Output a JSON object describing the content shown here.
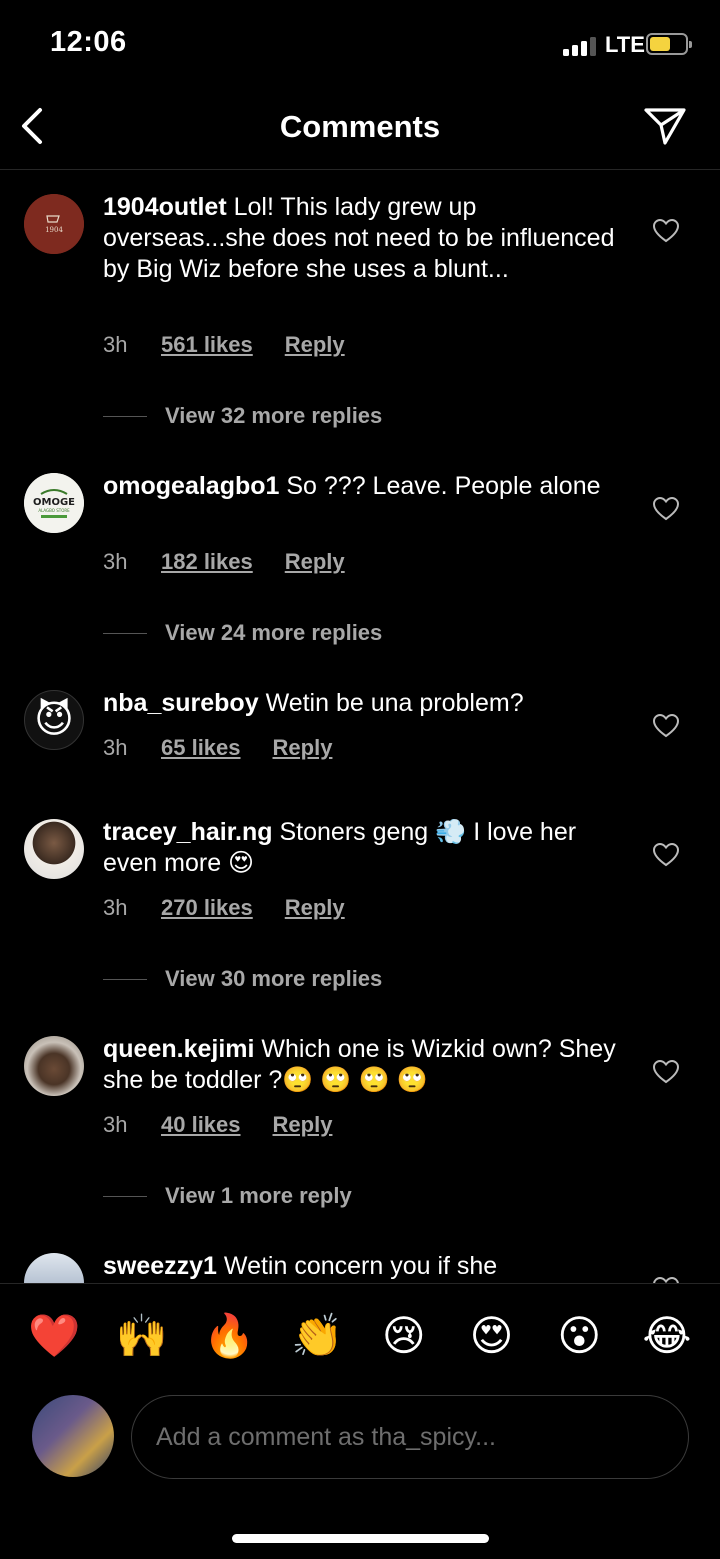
{
  "status": {
    "time": "12:06",
    "network": "LTE"
  },
  "header": {
    "title": "Comments"
  },
  "comments": [
    {
      "user": "1904outlet",
      "text": "Lol! This lady grew up overseas...she does not need to be influenced by Big Wiz before she uses a blunt...",
      "time": "3h",
      "likes": "561 likes",
      "reply": "Reply",
      "view_replies": "View 32 more replies"
    },
    {
      "user": "omogealagbo1",
      "text": "So ??? Leave. People alone",
      "time": "3h",
      "likes": "182 likes",
      "reply": "Reply",
      "view_replies": "View 24 more replies"
    },
    {
      "user": "nba_sureboy",
      "text": "Wetin be una problem?",
      "time": "3h",
      "likes": "65 likes",
      "reply": "Reply"
    },
    {
      "user": "tracey_hair.ng",
      "text": "Stoners geng 💨 I love her even more 😍",
      "time": "3h",
      "likes": "270 likes",
      "reply": "Reply",
      "view_replies": "View 30 more replies"
    },
    {
      "user": "queen.kejimi",
      "text": "Which one is Wizkid own? Shey she be toddler ?🙄 🙄 🙄 🙄",
      "time": "3h",
      "likes": "40 likes",
      "reply": "Reply",
      "view_replies": "View 1 more reply"
    },
    {
      "user": "sweezzy1",
      "text": "Wetin concern you if she"
    }
  ],
  "avatars": {
    "c1_label": "1904",
    "c2_label": "OMOGE",
    "c2_sub": "ALAGBO STORE"
  },
  "emoji_bar": [
    "❤️",
    "🙌",
    "🔥",
    "👏",
    "😢",
    "😍",
    "😮",
    "😂"
  ],
  "input": {
    "placeholder": "Add a comment as tha_spicy..."
  }
}
